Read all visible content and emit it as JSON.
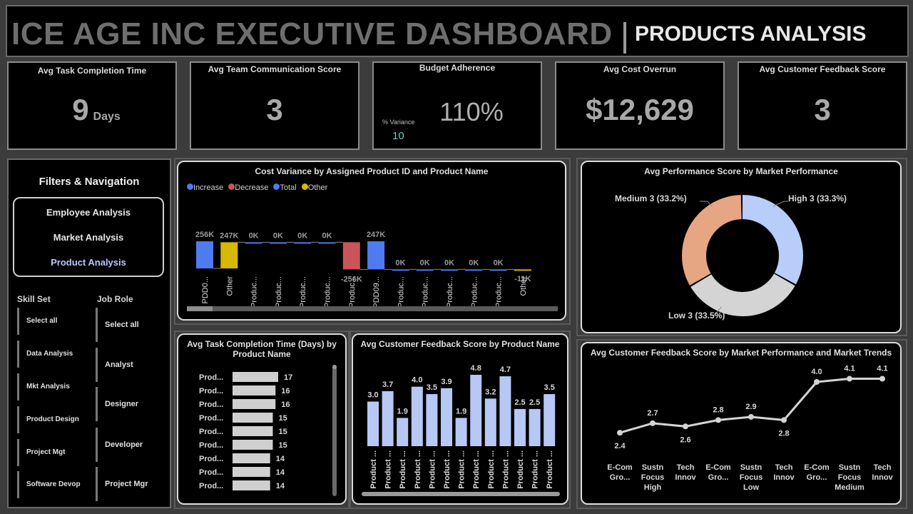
{
  "header": {
    "title": "ICE AGE INC EXECUTIVE DASHBOARD",
    "subtitle": "PRODUCTS ANALYSIS"
  },
  "kpis": {
    "task_time": {
      "title": "Avg Task Completion Time",
      "value": "9",
      "unit": "Days"
    },
    "team_comm": {
      "title": "Avg Team Communication Score",
      "value": "3"
    },
    "budget": {
      "title": "Budget Adherence",
      "value": "110%",
      "variance_label": "% Variance",
      "variance_value": "10"
    },
    "cost_overrun": {
      "title": "Avg Cost Overrun",
      "value": "$12,629"
    },
    "feedback": {
      "title": "Avg Customer Feedback Score",
      "value": "3"
    }
  },
  "nav": {
    "title": "Filters & Navigation",
    "buttons": [
      "Employee Analysis",
      "Market Analysis",
      "Product Analysis"
    ],
    "active": "Product Analysis",
    "skill_set": {
      "header": "Skill Set",
      "items": [
        "Select all",
        "Data Analysis",
        "Mkt Analysis",
        "Product Design",
        "Project Mgt",
        "Software Devop"
      ]
    },
    "job_role": {
      "header": "Job Role",
      "items": [
        "Select all",
        "Analyst",
        "Designer",
        "Developer",
        "Project Mgr"
      ]
    }
  },
  "colors": {
    "increase": "#4f7bf0",
    "decrease": "#c9555a",
    "total": "#4f7bf0",
    "other": "#d6b800",
    "bar_light": "#b7c8f5",
    "donut_high": "#b9cdfb",
    "donut_medium": "#e6a583",
    "donut_low": "#d4d4d4"
  },
  "chart_data": [
    {
      "type": "bar",
      "subtype": "waterfall",
      "title": "Cost Variance by Assigned Product ID and Product Name",
      "legend": [
        "Increase",
        "Decrease",
        "Total",
        "Other"
      ],
      "categories": [
        "PDD0...",
        "Other",
        "Produc...",
        "Produc...",
        "Produc...",
        "Produc...",
        "Produc...",
        "PDD09...",
        "Produc...",
        "Produc...",
        "Produc...",
        "Produc...",
        "Produc...",
        "Other"
      ],
      "kinds": [
        "total",
        "other",
        "increase",
        "increase",
        "increase",
        "increase",
        "decrease",
        "total",
        "increase",
        "increase",
        "increase",
        "increase",
        "increase",
        "other"
      ],
      "values": [
        256,
        247,
        0,
        0,
        0,
        0,
        -256,
        247,
        0,
        0,
        0,
        0,
        0,
        -11
      ],
      "labels": [
        "256K",
        "247K",
        "0K",
        "0K",
        "0K",
        "0K",
        "-256K",
        "247K",
        "0K",
        "0K",
        "0K",
        "0K",
        "0K",
        "-11K"
      ]
    },
    {
      "type": "pie",
      "subtype": "donut",
      "title": "Avg Performance Score by Market Performance",
      "slices": [
        {
          "label": "High 3 (33.3%)",
          "value": 33.3,
          "color": "#b9cdfb"
        },
        {
          "label": "Low 3 (33.5%)",
          "value": 33.5,
          "color": "#d4d4d4"
        },
        {
          "label": "Medium 3 (33.2%)",
          "value": 33.2,
          "color": "#e6a583"
        }
      ]
    },
    {
      "type": "bar",
      "orientation": "horizontal",
      "title": "Avg Task Completion Time (Days) by Product Name",
      "categories": [
        "Prod...",
        "Prod...",
        "Prod...",
        "Prod...",
        "Prod...",
        "Prod...",
        "Prod...",
        "Prod...",
        "Prod..."
      ],
      "values": [
        17,
        16,
        16,
        15,
        15,
        15,
        14,
        14,
        14
      ]
    },
    {
      "type": "bar",
      "title": "Avg Customer Feedback Score by Product Name",
      "categories": [
        "Product ...",
        "Product ...",
        "Product ...",
        "Product ...",
        "Product ...",
        "Product ...",
        "Product ...",
        "Product ...",
        "Product ...",
        "Product ...",
        "Product ...",
        "Product ...",
        "Product ..."
      ],
      "values": [
        3.0,
        3.7,
        1.9,
        4.0,
        3.5,
        3.9,
        1.9,
        4.8,
        3.2,
        4.7,
        2.5,
        2.5,
        3.5
      ],
      "labels": [
        "3.0",
        "3.7",
        "1.9",
        "4.0",
        "3.5",
        "3.9",
        "1.9",
        "4.8",
        "3.2",
        "4.7",
        "2.5",
        "2.5",
        "3.5"
      ]
    },
    {
      "type": "line",
      "title": "Avg Customer Feedback Score by Market Performance and Market Trends",
      "categories": [
        [
          "E-Com",
          "Gro..."
        ],
        [
          "Sustn",
          "Focus",
          "High"
        ],
        [
          "Tech",
          "Innov"
        ],
        [
          "E-Com",
          "Gro..."
        ],
        [
          "Sustn",
          "Focus",
          "Low"
        ],
        [
          "Tech",
          "Innov"
        ],
        [
          "E-Com",
          "Gro..."
        ],
        [
          "Sustn",
          "Focus",
          "Medium"
        ],
        [
          "Tech",
          "Innov"
        ]
      ],
      "values": [
        2.4,
        2.7,
        2.6,
        2.8,
        2.9,
        2.8,
        4.0,
        4.1,
        4.1
      ],
      "labels": [
        "2.4",
        "2.7",
        "2.6",
        "2.8",
        "2.9",
        "2.8",
        "4.0",
        "4.1",
        "4.1"
      ]
    }
  ]
}
